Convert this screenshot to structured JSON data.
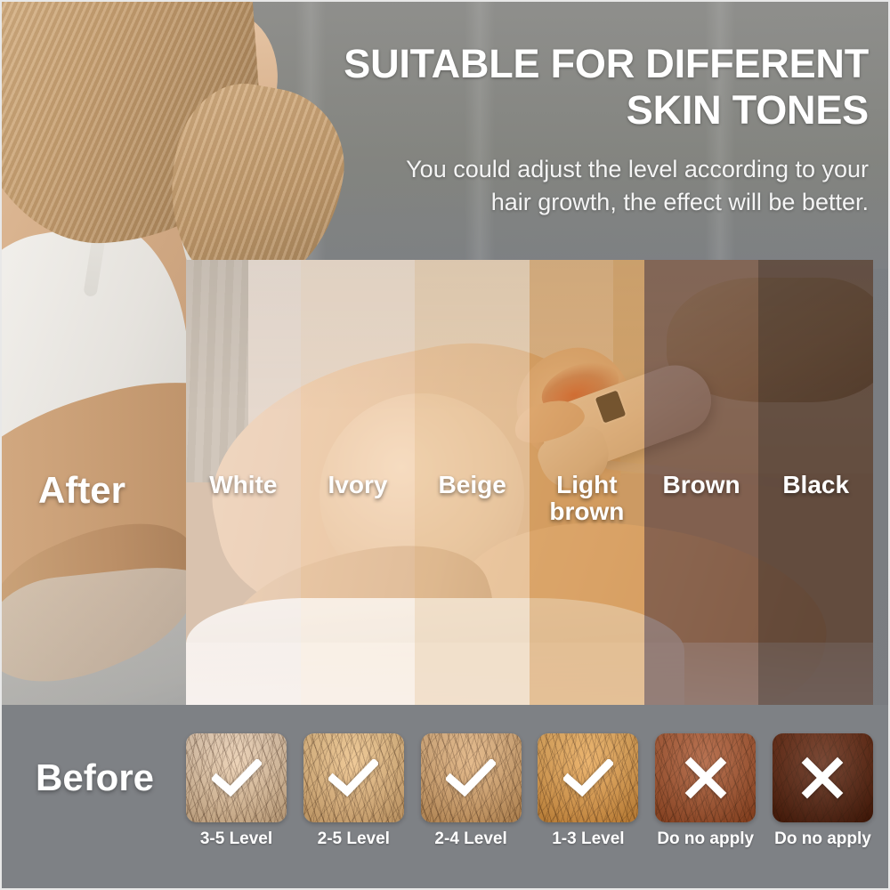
{
  "page": {
    "background_color": "#7e8185",
    "border_color": "#e8e8e8"
  },
  "header": {
    "headline_line1": "SUITABLE FOR DIFFERENT",
    "headline_line2": "SKIN TONES",
    "subhead_line1": "You could adjust the level according to your",
    "subhead_line2": "hair growth, the effect will be better."
  },
  "side_labels": {
    "after": "After",
    "before": "Before"
  },
  "tone_band": {
    "columns": [
      {
        "label": "White",
        "tint": "#f0e2dc",
        "tint_alpha": 0.42,
        "swatch_color": "#efd8c6"
      },
      {
        "label": "Ivory",
        "tint": "#f6ddc4",
        "tint_alpha": 0.34,
        "swatch_color": "#f2dcbe"
      },
      {
        "label": "Beige",
        "tint": "#e8c49b",
        "tint_alpha": 0.48,
        "swatch_color": "#e4bb8e"
      },
      {
        "label": "Light\nbrown",
        "label_line1": "Light",
        "label_line2": "brown",
        "tint": "#d08b3c",
        "tint_alpha": 0.52,
        "swatch_color": "#d79a46"
      },
      {
        "label": "Brown",
        "tint": "#553228",
        "tint_alpha": 0.62,
        "swatch_color": "#a9562c"
      },
      {
        "label": "Black",
        "tint": "#3b2720",
        "tint_alpha": 0.72,
        "swatch_color": "#5e2410"
      }
    ]
  },
  "swatches": [
    {
      "skin_top": "#f0d6bb",
      "skin_bottom": "#ddb98f",
      "mark": "check-icon",
      "level": "3-5 Level"
    },
    {
      "skin_top": "#f3c98e",
      "skin_bottom": "#e0b075",
      "mark": "check-icon",
      "level": "2-5 Level"
    },
    {
      "skin_top": "#e9bb87",
      "skin_bottom": "#d09a5e",
      "mark": "check-icon",
      "level": "2-4 Level"
    },
    {
      "skin_top": "#f0b362",
      "skin_bottom": "#da913c",
      "mark": "check-icon",
      "level": "1-3 Level"
    },
    {
      "skin_top": "#b5613a",
      "skin_bottom": "#9c4a23",
      "mark": "cross-icon",
      "level": "Do no apply"
    },
    {
      "skin_top": "#6d2d14",
      "skin_bottom": "#4a1a08",
      "mark": "cross-icon",
      "level": "Do no apply"
    }
  ],
  "device": {
    "name": "ipl-hair-removal-handset",
    "body_color": "#ead9c6",
    "screen_color": "#111a23"
  }
}
